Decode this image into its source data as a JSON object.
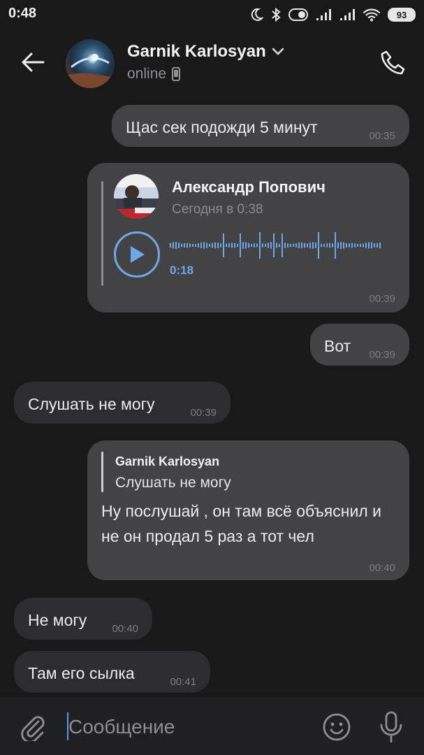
{
  "status_bar": {
    "time": "0:48",
    "battery": "93",
    "icons": [
      "moon-icon",
      "bluetooth-icon",
      "toggle-icon",
      "signal-icon",
      "signal-icon",
      "wifi-icon",
      "battery-icon"
    ]
  },
  "header": {
    "contact_name": "Garnik Karlosyan",
    "status": "online",
    "icons": [
      "back-arrow-icon",
      "chevron-down-icon",
      "phone-device-icon",
      "call-icon"
    ]
  },
  "messages": [
    {
      "dir": "out",
      "text": "Щас сек подожди 5 минут",
      "time": "00:35"
    },
    {
      "dir": "out",
      "type": "forwarded-voice",
      "from": "Александр Попович",
      "sent": "Сегодня в 0:38",
      "duration": "0:18",
      "time": "00:39"
    },
    {
      "dir": "out",
      "text": "Вот",
      "time": "00:39"
    },
    {
      "dir": "in",
      "text": "Слушать не могу",
      "time": "00:39"
    },
    {
      "dir": "out",
      "reply_to_name": "Garnik Karlosyan",
      "reply_to_text": "Слушать не могу",
      "text": "Ну послушай , он там всё объяснил и не он продал 5 раз а тот чел",
      "time": "00:40"
    },
    {
      "dir": "in",
      "text": "Не могу",
      "time": "00:40"
    },
    {
      "dir": "in",
      "text": "Там его сылка",
      "time": "00:41"
    }
  ],
  "composer": {
    "placeholder": "Сообщение",
    "icons": [
      "paperclip-icon",
      "emoji-icon",
      "microphone-icon"
    ]
  },
  "colors": {
    "background": "#19191a",
    "outgoing_bubble": "#434345",
    "incoming_bubble": "#2d2d2f",
    "accent": "#6fa8ea"
  }
}
